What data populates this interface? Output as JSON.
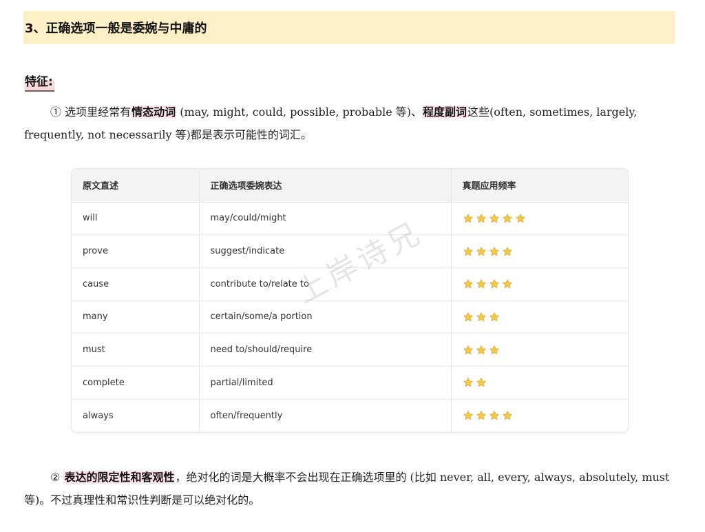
{
  "section_title": "3、正确选项一般是委婉与中庸的",
  "feature_label": "特征:",
  "paragraph1": {
    "marker": "①",
    "t1": " 选项里经常有",
    "h1": "情态动词",
    "t2": " (may, might, could, possible, probable 等)、",
    "h2": "程度副词",
    "t3": "这些(often, sometimes, largely, frequently, not necessarily 等)都是表示可能性的词汇。"
  },
  "table": {
    "headers": [
      "原文直述",
      "正确选项委婉表达",
      "真题应用频率"
    ],
    "rows": [
      {
        "original": "will",
        "hedged": "may/could/might",
        "stars": 5
      },
      {
        "original": "prove",
        "hedged": "suggest/indicate",
        "stars": 4
      },
      {
        "original": "cause",
        "hedged": "contribute to/relate to",
        "stars": 4
      },
      {
        "original": "many",
        "hedged": "certain/some/a portion",
        "stars": 3
      },
      {
        "original": "must",
        "hedged": "need to/should/require",
        "stars": 3
      },
      {
        "original": "complete",
        "hedged": "partial/limited",
        "stars": 2
      },
      {
        "original": "always",
        "hedged": "often/frequently",
        "stars": 4
      }
    ],
    "star_color": "#f2c94c",
    "star_stroke": "#e0a92e"
  },
  "watermark": "上岸诗兄",
  "paragraph2": {
    "marker": "②",
    "h1": "表达的限定性和客观性",
    "t1": "，绝对化的词是大概率不会出现在正确选项里的 (比如 never, all, every, always, absolutely, must 等)。不过真理性和常识性判断是可以绝对化的。"
  }
}
